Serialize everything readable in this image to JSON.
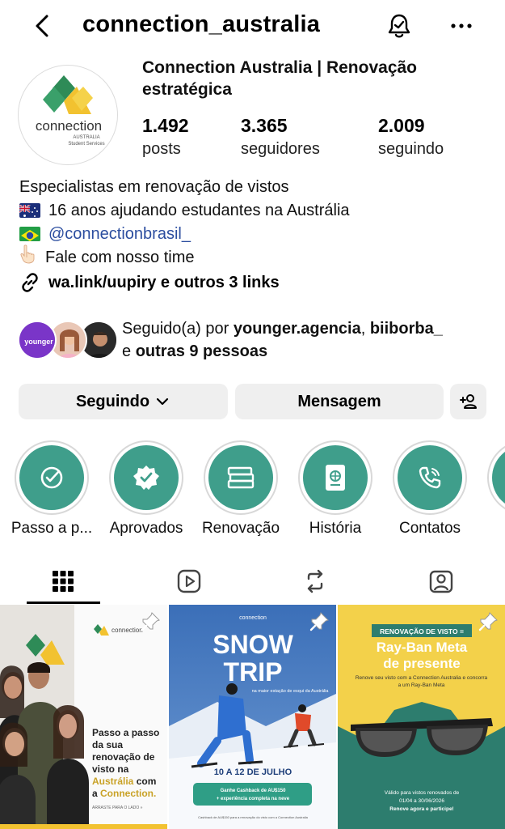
{
  "header": {
    "username": "connection_australia"
  },
  "profile": {
    "display_name": "Connection Australia | Renovação estratégica",
    "avatar_logo_text": "connection",
    "avatar_logo_sub1": "AUSTRALIA",
    "avatar_logo_sub2": "Student Services",
    "stats": [
      {
        "value": "1.492",
        "label": "posts"
      },
      {
        "value": "3.365",
        "label": "seguidores"
      },
      {
        "value": "2.009",
        "label": "seguindo"
      }
    ]
  },
  "bio": {
    "line1": "Especialistas em renovação de vistos",
    "line2": "16 anos ajudando estudantes na Austrália",
    "line3_mention": "@connectionbrasil_",
    "line4": "Fale com nosso time",
    "links": "wa.link/uupiry e outros 3 links"
  },
  "followed_by": {
    "prefix": "Seguido(a) por ",
    "user1": "younger.agencia",
    "sep": ", ",
    "user2": "biiborba_",
    "middle": "e ",
    "others": "outras 9 pessoas",
    "avatar1_text": "younger"
  },
  "actions": {
    "following_label": "Seguindo",
    "message_label": "Mensagem"
  },
  "highlights": [
    {
      "label": "Passo a p...",
      "icon": "check-circle-icon"
    },
    {
      "label": "Aprovados",
      "icon": "verified-badge-icon"
    },
    {
      "label": "Renovação",
      "icon": "books-icon"
    },
    {
      "label": "História",
      "icon": "passport-icon"
    },
    {
      "label": "Contatos",
      "icon": "phone-icon"
    }
  ],
  "tabs": [
    "grid-icon",
    "reels-icon",
    "reposts-icon",
    "tagged-icon"
  ],
  "posts": [
    {
      "logo": "connection",
      "line1": "Passo a passo",
      "line2": "da sua",
      "line3": "renovação de",
      "line4": "visto na",
      "highlight1": "Austrália",
      "line5": " com",
      "line6a": "a ",
      "highlight2": "Connection.",
      "cta": "ARRASTE PARA O LADO »"
    },
    {
      "logo": "connection",
      "title1": "SNOW",
      "title2": "TRIP",
      "subtitle": "na maior estação de esqui da Austrália",
      "date": "10 A 12 DE JULHO",
      "cashback1": "Ganhe Cashback de AU$150",
      "cashback2": "+ experiência completa na neve",
      "footer": "Cashback de AU$150 para a renovação do visto com a Connection Australia"
    },
    {
      "tag": "RENOVAÇÃO DE VISTO =",
      "title1": "Ray-Ban Meta",
      "title2": "de presente",
      "body": "Renove seu visto com a Connection Australia e concorra a um Ray-Ban Meta",
      "footer1": "Válido para vistos renovados de",
      "footer2": "01/04 a 30/06/2026",
      "footer3": "Renove agora e participe!"
    }
  ],
  "colors": {
    "accent_teal": "#3f9e8b",
    "mention_blue": "#2b4d9f",
    "button_gray": "#efefef",
    "logo_green": "#2e8b57",
    "logo_yellow": "#f2c230",
    "snow_blue": "#2d5fa6",
    "rayban_yellow": "#f3d14a",
    "rayban_teal": "#2d7d6e"
  }
}
